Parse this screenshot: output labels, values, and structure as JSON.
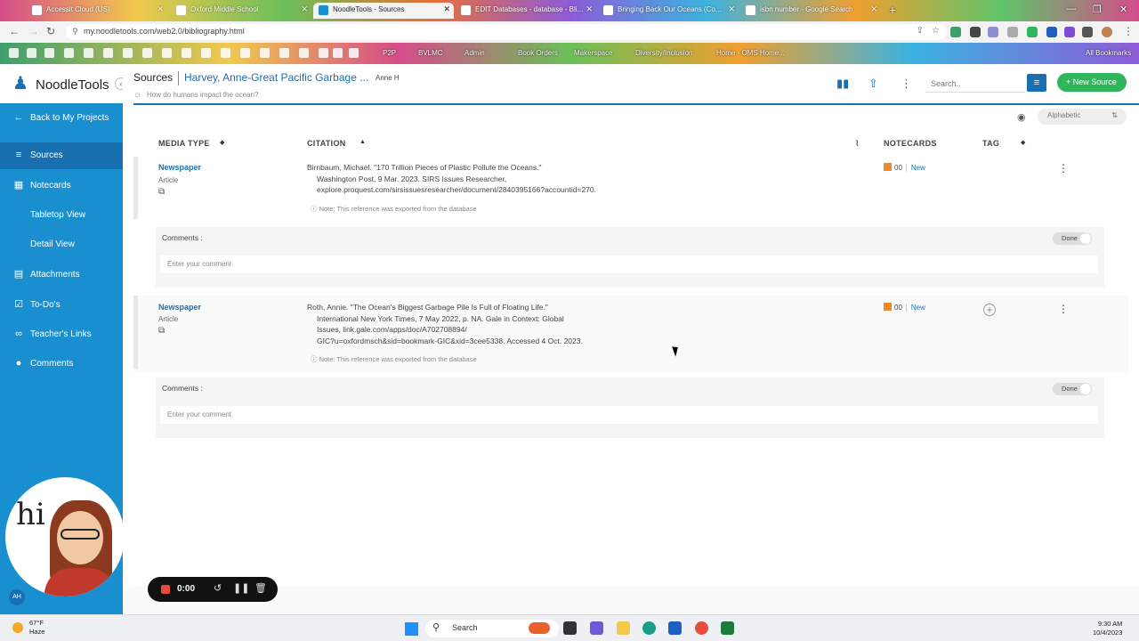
{
  "browser": {
    "tabs": [
      {
        "title": "Accessit Cloud (US)",
        "active": false
      },
      {
        "title": "Oxford Middle School",
        "active": false
      },
      {
        "title": "NoodleTools - Sources",
        "active": true
      },
      {
        "title": "EDIT Databases - database - Bli...",
        "active": false
      },
      {
        "title": "Bringing Back Our Oceans (Co...",
        "active": false
      },
      {
        "title": "isbn number - Google Search",
        "active": false
      }
    ],
    "new_tab": "+",
    "url": "my.noodletools.com/web2.0/bibliography.html",
    "bookmarks": [
      "P2P",
      "BVLMC",
      "Admin",
      "Book Orders",
      "Makerspace",
      "Diversity/Inclusion",
      "Home - OMS Home..."
    ],
    "all_bookmarks": "All Bookmarks"
  },
  "app": {
    "logo": "NoodleTools",
    "collapse_icon": "‹",
    "sources_label": "Sources",
    "project_title": "Harvey, Anne-Great Pacific Garbage ...",
    "owner": "Anne H",
    "question": "How do humans impact the ocean?",
    "search_placeholder": "Search..",
    "new_source": "+ New Source",
    "sort_label": "Alphabetic",
    "accent": "#1a8fd0",
    "green": "#2fb55a"
  },
  "sidebar": {
    "items": [
      {
        "label": "Back to My Projects",
        "icon": "←"
      },
      {
        "label": "Sources",
        "icon": "≡"
      },
      {
        "label": "Notecards",
        "icon": "▦"
      },
      {
        "label": "Tabletop View",
        "icon": ""
      },
      {
        "label": "Detail View",
        "icon": ""
      },
      {
        "label": "Attachments",
        "icon": "▤"
      },
      {
        "label": "To-Do's",
        "icon": "☑"
      },
      {
        "label": "Teacher's Links",
        "icon": "🔗"
      },
      {
        "label": "Comments",
        "icon": "●"
      }
    ]
  },
  "table": {
    "headers": {
      "media": "MEDIA TYPE",
      "citation": "CITATION",
      "notecards": "NOTECARDS",
      "tag": "TAG"
    },
    "rows": [
      {
        "media": "Newspaper",
        "type": "Article",
        "cite_line1": "Birnbaum, Michael. \"170 Trillion Pieces of Plastic Pollute the Oceans.\"",
        "cite_line2": "Washington Post, 9 Mar. 2023. SIRS Issues Researcher,",
        "cite_line3": "explore.proquest.com/sirsissuesresearcher/document/2840395166?accountid=270.",
        "note": "Note: This reference was exported from the database",
        "notecards": "00",
        "new_label": "New",
        "comments_label": "Comments :",
        "comment_placeholder": "Enter your comment",
        "done": "Done"
      },
      {
        "media": "Newspaper",
        "type": "Article",
        "cite_line1": "Roth, Annie. \"The Ocean's Biggest Garbage Pile Is Full of Floating Life.\"",
        "cite_line2": "International New York Times, 7 May 2022, p. NA. Gale in Context: Global",
        "cite_line3": "Issues, link.gale.com/apps/doc/A702708894/",
        "cite_line4": "GIC?u=oxfordmsch&sid=bookmark-GIC&xid=3cee5338. Accessed 4 Oct. 2023.",
        "note": "Note: This reference was exported from the database",
        "notecards": "00",
        "new_label": "New",
        "comments_label": "Comments :",
        "comment_placeholder": "Enter your comment",
        "done": "Done"
      }
    ]
  },
  "recorder": {
    "greeting": "hi",
    "time": "0:00",
    "user_initials": "AH"
  },
  "taskbar": {
    "temp": "67°F",
    "weather": "Haze",
    "search": "Search",
    "time": "9:30 AM",
    "date": "10/4/2023"
  }
}
